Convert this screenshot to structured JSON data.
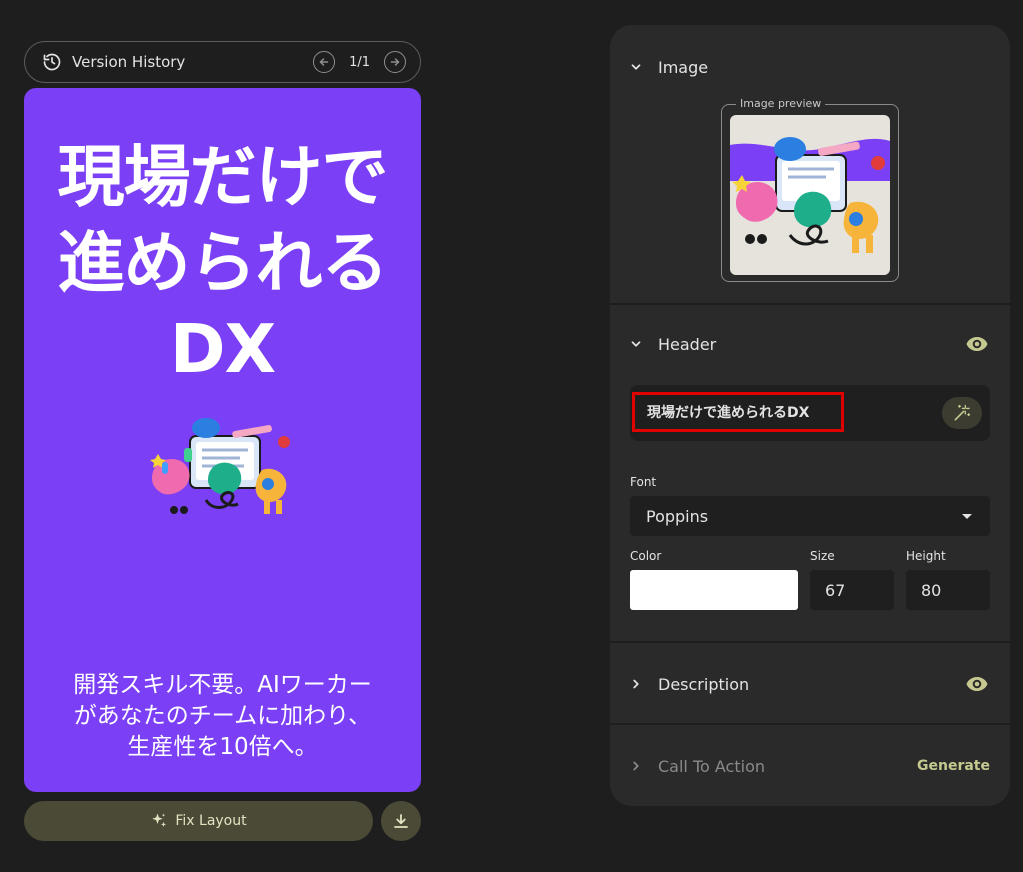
{
  "version_bar": {
    "title": "Version History",
    "counter": "1/1"
  },
  "canvas": {
    "background": "#7b3ff5",
    "header_lines": [
      "現場だけで",
      "進められる",
      "DX"
    ],
    "description_lines": [
      "開発スキル不要。AIワーカー",
      "があなたのチームに加わり、",
      "生産性を10倍へ。"
    ]
  },
  "actions": {
    "fix_layout_label": "Fix Layout"
  },
  "panel": {
    "image_section": {
      "label": "Image",
      "preview_legend": "Image preview"
    },
    "header_section": {
      "label": "Header",
      "text_value": "現場だけで進められるDX",
      "font_label": "Font",
      "font_value": "Poppins",
      "color_label": "Color",
      "color_value": "#ffffff",
      "size_label": "Size",
      "size_value": "67",
      "height_label": "Height",
      "height_value": "80"
    },
    "description_section": {
      "label": "Description"
    },
    "cta_section": {
      "label": "Call To Action",
      "generate_label": "Generate"
    }
  },
  "colors": {
    "accent_olive": "#c5c98f",
    "highlight_red": "#e00000"
  }
}
